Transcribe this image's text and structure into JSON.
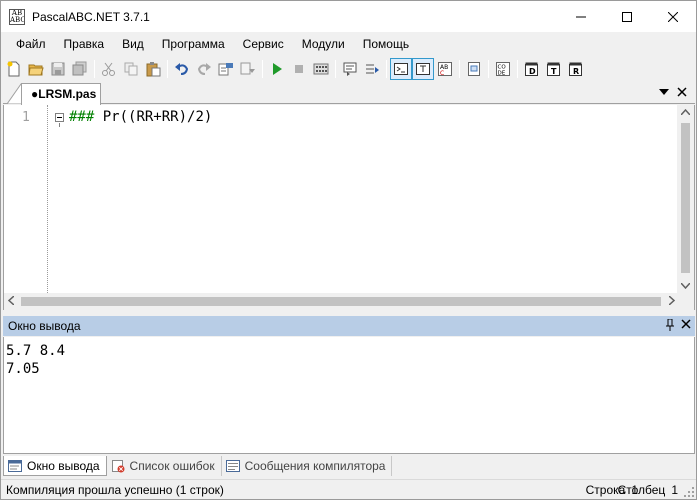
{
  "window": {
    "title": "PascalABC.NET 3.7.1",
    "icon_text_top": "AB",
    "icon_text_bottom": "ABC"
  },
  "menu": {
    "items": [
      "Файл",
      "Правка",
      "Вид",
      "Программа",
      "Сервис",
      "Модули",
      "Помощь"
    ]
  },
  "toolbar": {
    "buttons": [
      "new-file-icon",
      "open-folder-icon",
      "save-icon",
      "save-all-icon",
      "cut-icon",
      "copy-icon",
      "paste-icon",
      "undo-icon",
      "redo-icon",
      "find-icon",
      "replace-icon",
      "run-icon",
      "stop-icon",
      "compile-icon",
      "step-icon",
      "step-over-icon",
      "output-window-icon",
      "text-mode-icon",
      "abc-icon",
      "debug-window-icon",
      "code-icon",
      "d-button-icon",
      "t-button-icon",
      "r-button-icon"
    ]
  },
  "editor": {
    "tab_label": "●LRSM.pas",
    "line_number": "1",
    "code_comment": "###",
    "code_rest": " Pr((RR+RR)/2)"
  },
  "output": {
    "title": "Окно вывода",
    "lines": [
      "5.7 8.4",
      "7.05"
    ]
  },
  "bottom_tabs": {
    "output": "Окно вывода",
    "errors": "Список ошибок",
    "compiler": "Сообщения компилятора"
  },
  "status": {
    "message": "Компиляция прошла успешно (1 строк)",
    "row_label": "Строка",
    "row_value": "1",
    "col_label": "Столбец",
    "col_value": "1"
  },
  "colors": {
    "output_header_bg": "#b8cde6",
    "comment_color": "#008000",
    "active_button_border": "#3399cc"
  }
}
